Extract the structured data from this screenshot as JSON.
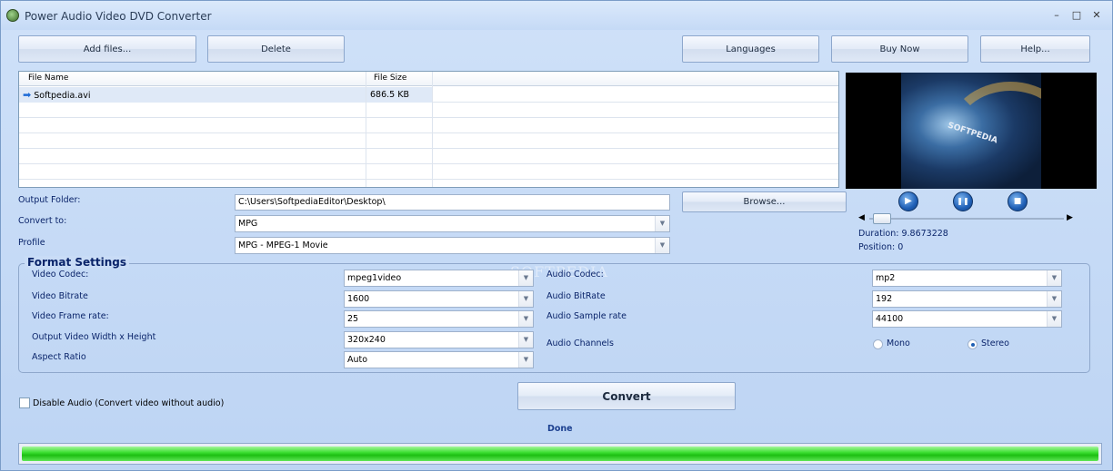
{
  "window": {
    "title": "Power Audio Video DVD Converter",
    "minimize": "–",
    "maximize": "□",
    "close": "✕"
  },
  "toolbar": {
    "add_files": "Add files...",
    "delete": "Delete",
    "languages": "Languages",
    "buy_now": "Buy Now",
    "help": "Help..."
  },
  "file_list": {
    "columns": [
      "File Name",
      "File Size"
    ],
    "rows": [
      {
        "name": "Softpedia.avi",
        "size": "686.5 KB"
      }
    ]
  },
  "preview": {
    "overlay_text": "SOFTPEDIA"
  },
  "output": {
    "folder_label": "Output Folder:",
    "folder_value": "C:\\Users\\SoftpediaEditor\\Desktop\\",
    "browse": "Browse...",
    "convert_to_label": "Convert to:",
    "convert_to_value": "MPG",
    "profile_label": "Profile",
    "profile_value": "MPG - MPEG-1 Movie"
  },
  "player": {
    "play": "▶",
    "pause": "❚❚",
    "stop": "■",
    "duration": "Duration: 9.8673228",
    "position": "Position: 0"
  },
  "format": {
    "title": "Format Settings",
    "video_codec_label": "Video Codec:",
    "video_codec": "mpeg1video",
    "video_bitrate_label": "Video Bitrate",
    "video_bitrate": "1600",
    "frame_rate_label": "Video Frame rate:",
    "frame_rate": "25",
    "size_label": "Output Video Width x Height",
    "size": "320x240",
    "aspect_label": "Aspect Ratio",
    "aspect": "Auto",
    "audio_codec_label": "Audio Codec:",
    "audio_codec": "mp2",
    "audio_bitrate_label": "Audio BitRate",
    "audio_bitrate": "192",
    "sample_rate_label": "Audio Sample rate",
    "sample_rate": "44100",
    "channels_label": "Audio Channels",
    "mono": "Mono",
    "stereo": "Stereo",
    "selected_channel": "Stereo"
  },
  "disable_audio": "Disable Audio (Convert video without audio)",
  "convert": "Convert",
  "status": "Done",
  "progress_fraction": 1.0,
  "watermark": "SOFTPEDIA"
}
